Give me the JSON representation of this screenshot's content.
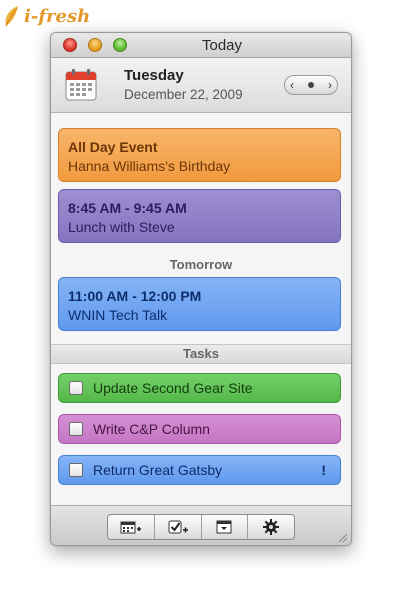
{
  "watermark": {
    "text": "i-fresh"
  },
  "window": {
    "title": "Today"
  },
  "header": {
    "day": "Tuesday",
    "date": "December 22, 2009",
    "nav": {
      "prev": "‹",
      "next": "›"
    }
  },
  "events": [
    {
      "time": "All Day Event",
      "title": "Hanna Williams's Birthday",
      "color": "#f5a452"
    },
    {
      "time": "8:45 AM - 9:45 AM",
      "title": "Lunch with Steve",
      "color": "#8e7ec7"
    }
  ],
  "tomorrow": {
    "heading": "Tomorrow",
    "events": [
      {
        "time": "11:00 AM - 12:00 PM",
        "title": "WNIN Tech Talk",
        "color": "#6fa5f2"
      }
    ]
  },
  "tasks": {
    "heading": "Tasks",
    "items": [
      {
        "label": "Update Second Gear Site",
        "flag": "",
        "color": "#62c456"
      },
      {
        "label": "Write C&P Column",
        "flag": "",
        "color": "#cc82cb"
      },
      {
        "label": "Return Great Gatsby",
        "flag": "!",
        "color": "#6fa5f2"
      }
    ]
  },
  "footer": {
    "buttons": [
      "new-event-icon",
      "new-task-icon",
      "menu-icon",
      "gear-icon"
    ]
  }
}
